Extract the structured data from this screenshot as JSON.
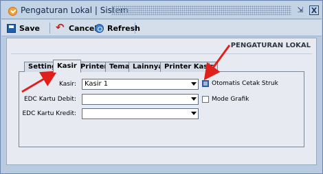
{
  "window": {
    "title": "Pengaturan Lokal | Sistem",
    "restore_glyph": "⇲",
    "close_glyph": "X"
  },
  "toolbar": {
    "save_label": "Save",
    "cancel_label": "Cancel",
    "refresh_label": "Refresh"
  },
  "panel": {
    "title": "PENGATURAN LOKAL"
  },
  "tabs": [
    {
      "label": "Setting",
      "active": false
    },
    {
      "label": "Kasir",
      "active": true
    },
    {
      "label": "Printer",
      "active": false
    },
    {
      "label": "Tema",
      "active": false
    },
    {
      "label": "Lainnya",
      "active": false
    },
    {
      "label": "Printer Kasir",
      "active": false
    }
  ],
  "form": {
    "kasir_label": "Kasir:",
    "kasir_value": "Kasir 1",
    "edc_debit_label": "EDC Kartu Debit:",
    "edc_debit_value": "",
    "edc_kredit_label": "EDC Kartu Kredit:",
    "edc_kredit_value": "",
    "auto_print_label": "Otomatis Cetak Struk",
    "auto_print_checked": false,
    "graphic_mode_label": "Mode Grafik",
    "graphic_mode_checked": false
  },
  "colors": {
    "annotation_arrow": "#e0201a",
    "window_bg": "#b9cbe1",
    "panel_bg": "#e7ebf1"
  }
}
